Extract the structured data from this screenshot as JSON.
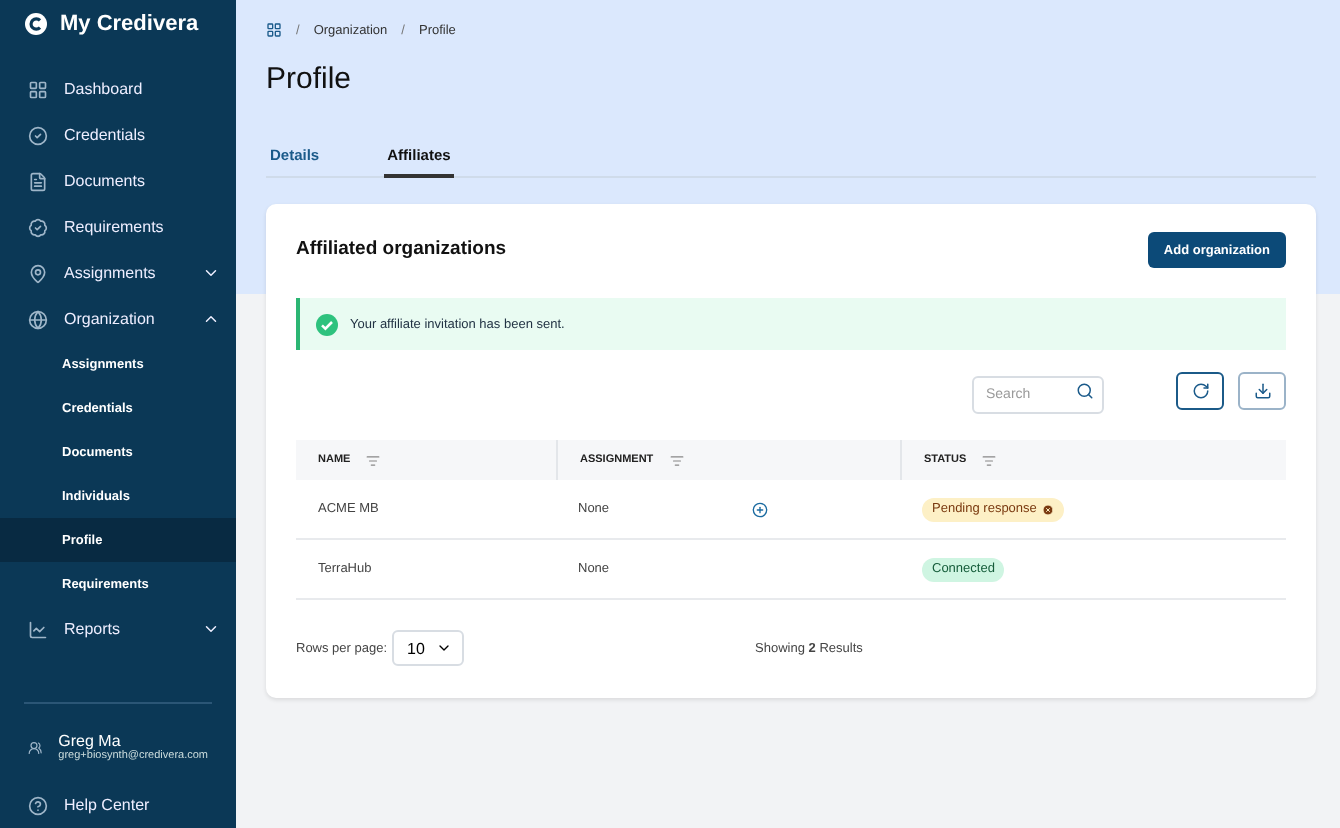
{
  "brand": {
    "name": "My Credivera"
  },
  "nav": [
    {
      "label": "Dashboard"
    },
    {
      "label": "Credentials"
    },
    {
      "label": "Documents"
    },
    {
      "label": "Requirements"
    },
    {
      "label": "Assignments",
      "expanded": false
    },
    {
      "label": "Organization",
      "expanded": true,
      "children": [
        {
          "label": "Assignments",
          "selected": false
        },
        {
          "label": "Credentials",
          "selected": false
        },
        {
          "label": "Documents",
          "selected": false
        },
        {
          "label": "Individuals",
          "selected": false
        },
        {
          "label": "Profile",
          "selected": true
        },
        {
          "label": "Requirements",
          "selected": false
        }
      ]
    },
    {
      "label": "Reports",
      "expanded": false
    }
  ],
  "user": {
    "name": "Greg Ma",
    "email": "greg+biosynth@credivera.com"
  },
  "help": {
    "label": "Help Center"
  },
  "breadcrumb": {
    "separator": "/",
    "items": [
      "Organization",
      "Profile"
    ]
  },
  "title": "Profile",
  "tabs": [
    {
      "label": "Details",
      "selected": false
    },
    {
      "label": "Affiliates",
      "selected": true
    }
  ],
  "card": {
    "title": "Affiliated organizations",
    "add_button": "Add organization",
    "alert": "Your affiliate invitation has been sent.",
    "search": {
      "placeholder": "Search"
    },
    "columns": [
      "NAME",
      "ASSIGNMENT",
      "STATUS"
    ],
    "rows": [
      {
        "name": "ACME MB",
        "assignment": "None",
        "assignable": true,
        "status": {
          "label": "Pending response",
          "kind": "pending"
        }
      },
      {
        "name": "TerraHub",
        "assignment": "None",
        "assignable": false,
        "status": {
          "label": "Connected",
          "kind": "connected"
        }
      }
    ],
    "rows_per_page": {
      "label": "Rows per page:",
      "value": "10"
    },
    "summary": "Showing **2** Results"
  }
}
